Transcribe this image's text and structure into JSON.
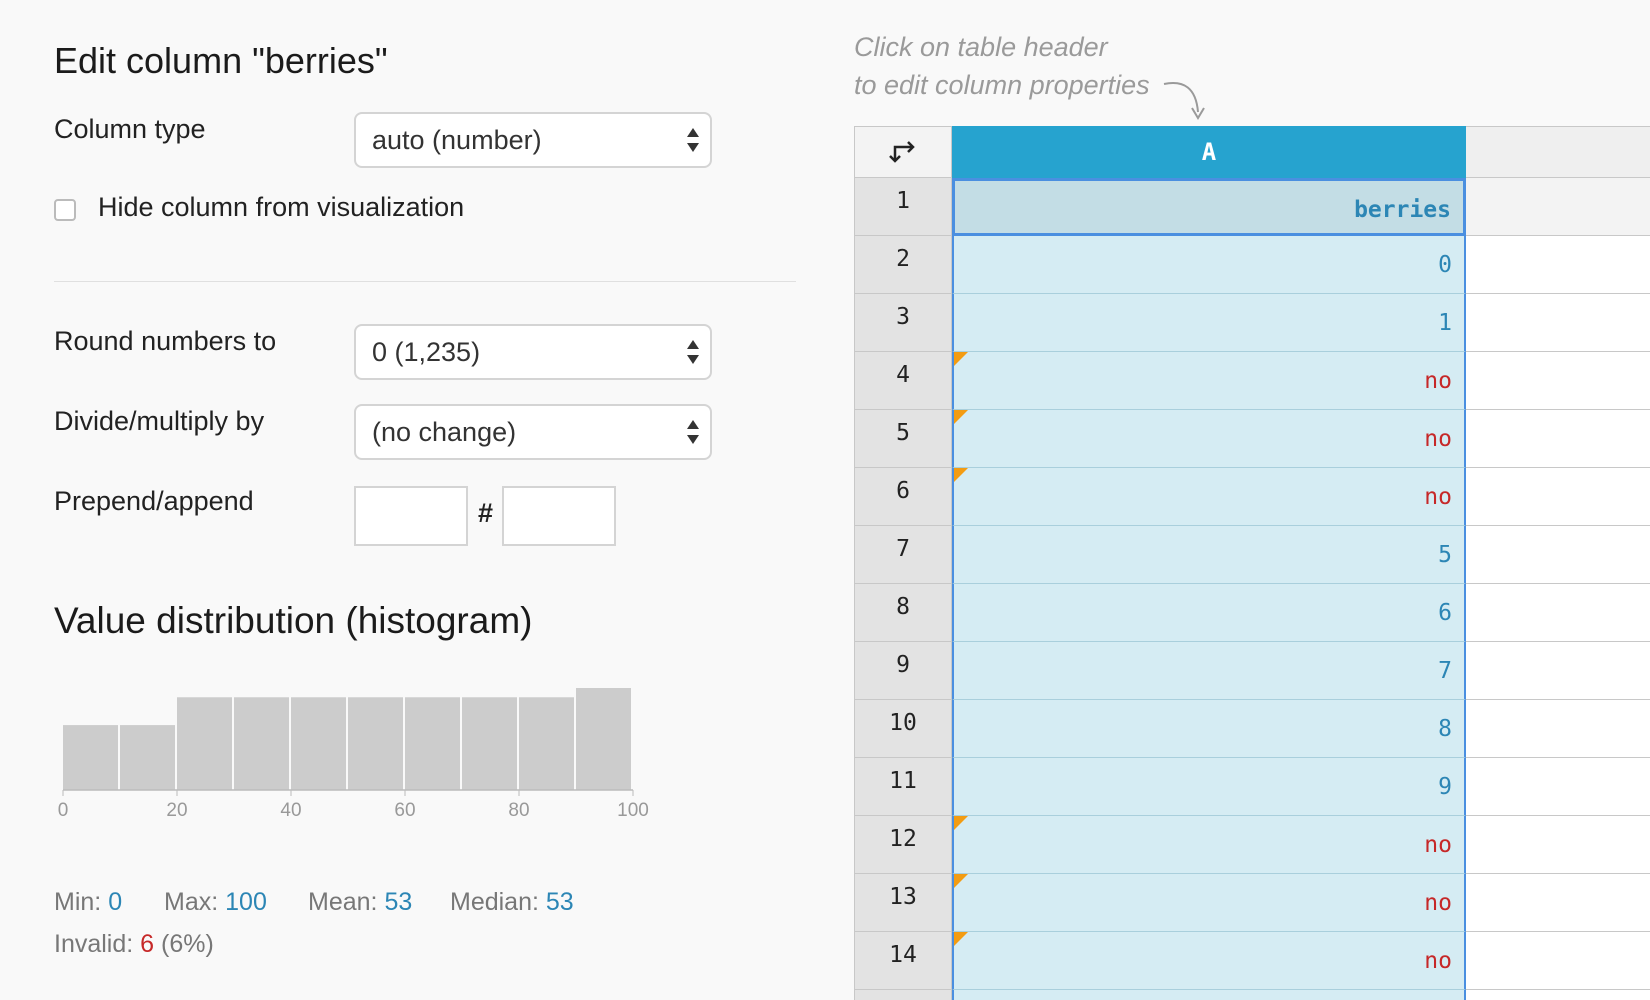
{
  "panel": {
    "title": "Edit column \"berries\"",
    "column_type_label": "Column type",
    "column_type_value": "auto (number)",
    "hide_label": "Hide column from visualization",
    "hide_checked": false,
    "round_label": "Round numbers to",
    "round_value": "0 (1,235)",
    "divide_label": "Divide/multiply by",
    "divide_value": "(no change)",
    "prepend_label": "Prepend/append",
    "prepend_value": "",
    "hash_symbol": "#",
    "append_value": ""
  },
  "histogram": {
    "title": "Value distribution (histogram)",
    "chart_data": {
      "type": "bar",
      "categories": [
        "0-10",
        "10-20",
        "20-30",
        "30-40",
        "40-50",
        "50-60",
        "60-70",
        "70-80",
        "80-90",
        "90-100"
      ],
      "values": [
        7,
        7,
        10,
        10,
        10,
        10,
        10,
        10,
        10,
        11
      ],
      "xlim": [
        0,
        100
      ],
      "ticks": [
        "0",
        "20",
        "40",
        "60",
        "80",
        "100"
      ],
      "bar_color": "#cccccc"
    },
    "stats": {
      "min_label": "Min:",
      "min_value": "0",
      "max_label": "Max:",
      "max_value": "100",
      "mean_label": "Mean:",
      "mean_value": "53",
      "median_label": "Median:",
      "median_value": "53",
      "invalid_label": "Invalid:",
      "invalid_value": "6",
      "invalid_pct": "(6%)"
    }
  },
  "hint": {
    "line1": "Click on table header",
    "line2": "to edit column properties"
  },
  "table": {
    "corner_icon": "transpose-icon",
    "column_header": "A",
    "rows": [
      {
        "num": "1",
        "value": "berries",
        "kind": "head",
        "flag": false
      },
      {
        "num": "2",
        "value": "0",
        "kind": "num",
        "flag": false
      },
      {
        "num": "3",
        "value": "1",
        "kind": "num",
        "flag": false
      },
      {
        "num": "4",
        "value": "no",
        "kind": "txt",
        "flag": true
      },
      {
        "num": "5",
        "value": "no",
        "kind": "txt",
        "flag": true
      },
      {
        "num": "6",
        "value": "no",
        "kind": "txt",
        "flag": true
      },
      {
        "num": "7",
        "value": "5",
        "kind": "num",
        "flag": false
      },
      {
        "num": "8",
        "value": "6",
        "kind": "num",
        "flag": false
      },
      {
        "num": "9",
        "value": "7",
        "kind": "num",
        "flag": false
      },
      {
        "num": "10",
        "value": "8",
        "kind": "num",
        "flag": false
      },
      {
        "num": "11",
        "value": "9",
        "kind": "num",
        "flag": false
      },
      {
        "num": "12",
        "value": "no",
        "kind": "txt",
        "flag": true
      },
      {
        "num": "13",
        "value": "no",
        "kind": "txt",
        "flag": true
      },
      {
        "num": "14",
        "value": "no",
        "kind": "txt",
        "flag": true
      },
      {
        "num": "",
        "value": "",
        "kind": "num",
        "flag": false
      }
    ]
  },
  "colors": {
    "accent": "#26a3cf",
    "selection": "#4a8fe0",
    "number": "#2c86b5",
    "invalid": "#c62828",
    "flag": "#f39c12"
  }
}
